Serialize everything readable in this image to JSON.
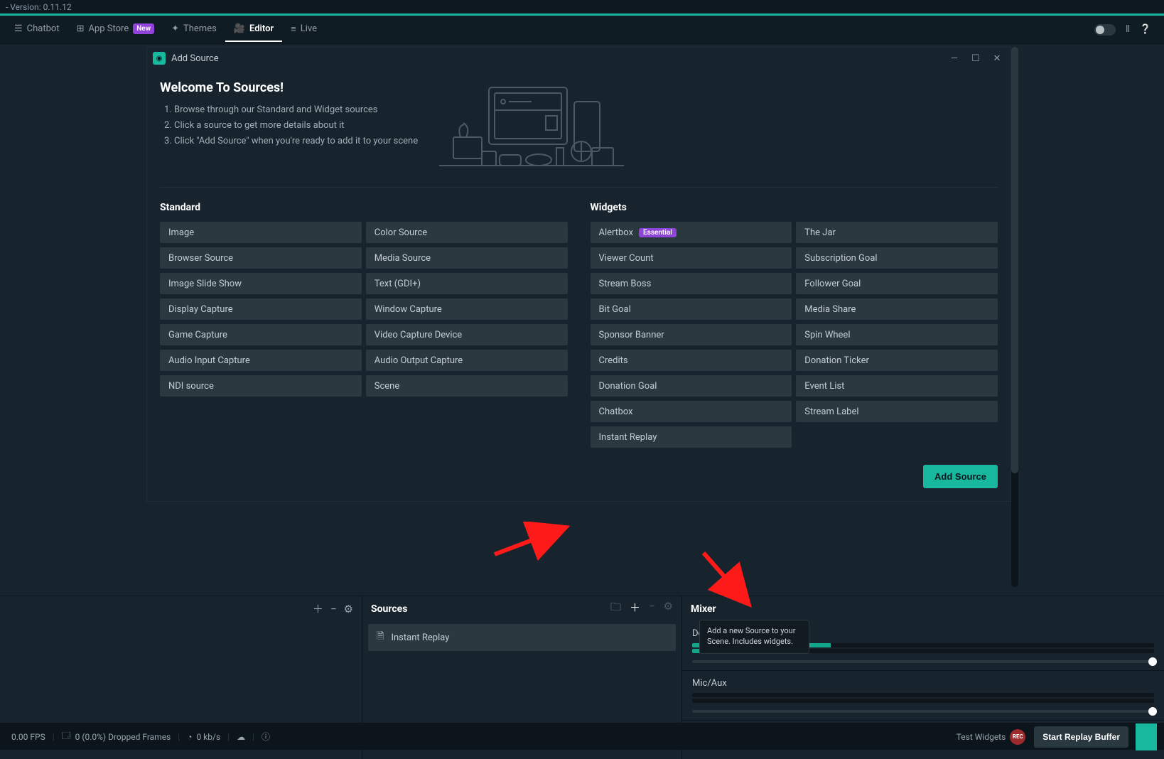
{
  "app": {
    "title": "- Version: 0.11.12"
  },
  "nav": {
    "items": [
      {
        "label": "Chatbot",
        "icon": "chat-icon",
        "active": false
      },
      {
        "label": "App Store",
        "icon": "appstore-icon",
        "badge": "New",
        "active": false
      },
      {
        "label": "Themes",
        "icon": "themes-icon",
        "active": false
      },
      {
        "label": "Editor",
        "icon": "editor-icon",
        "active": true
      },
      {
        "label": "Live",
        "icon": "live-icon",
        "active": false
      }
    ]
  },
  "modal": {
    "title": "Add Source",
    "hero": {
      "heading": "Welcome To Sources!",
      "steps": [
        "Browse through our Standard and Widget sources",
        "Click a source to get more details about it",
        "Click \"Add Source\" when you're ready to add it to your scene"
      ]
    },
    "standard": {
      "heading": "Standard",
      "col1": [
        "Image",
        "Browser Source",
        "Image Slide Show",
        "Display Capture",
        "Game Capture",
        "Audio Input Capture",
        "NDI source"
      ],
      "col2": [
        "Color Source",
        "Media Source",
        "Text (GDI+)",
        "Window Capture",
        "Video Capture Device",
        "Audio Output Capture",
        "Scene"
      ]
    },
    "widgets": {
      "heading": "Widgets",
      "col1": [
        {
          "label": "Alertbox",
          "badge": "Essential"
        },
        {
          "label": "Viewer Count"
        },
        {
          "label": "Stream Boss"
        },
        {
          "label": "Bit Goal"
        },
        {
          "label": "Sponsor Banner"
        },
        {
          "label": "Credits"
        },
        {
          "label": "Donation Goal"
        },
        {
          "label": "Chatbox"
        },
        {
          "label": "Instant Replay"
        }
      ],
      "col2": [
        {
          "label": "The Jar"
        },
        {
          "label": "Subscription Goal"
        },
        {
          "label": "Follower Goal"
        },
        {
          "label": "Media Share"
        },
        {
          "label": "Spin Wheel"
        },
        {
          "label": "Donation Ticker"
        },
        {
          "label": "Event List"
        },
        {
          "label": "Stream Label"
        }
      ]
    },
    "button": "Add Source"
  },
  "panels": {
    "sources_heading": "Sources",
    "mixer_heading": "Mixer",
    "source_list": [
      {
        "label": "Instant Replay"
      }
    ],
    "mixer_list": [
      {
        "name": "Desktop Audio"
      },
      {
        "name": "Mic/Aux"
      }
    ]
  },
  "tooltip": "Add a new Source to your Scene. Includes widgets.",
  "bottombar": {
    "fps": "0.00 FPS",
    "dropped": "0 (0.0%) Dropped Frames",
    "bitrate": "0 kb/s",
    "test_widgets": "Test Widgets",
    "rec": "REC",
    "start_buffer": "Start Replay Buffer"
  }
}
